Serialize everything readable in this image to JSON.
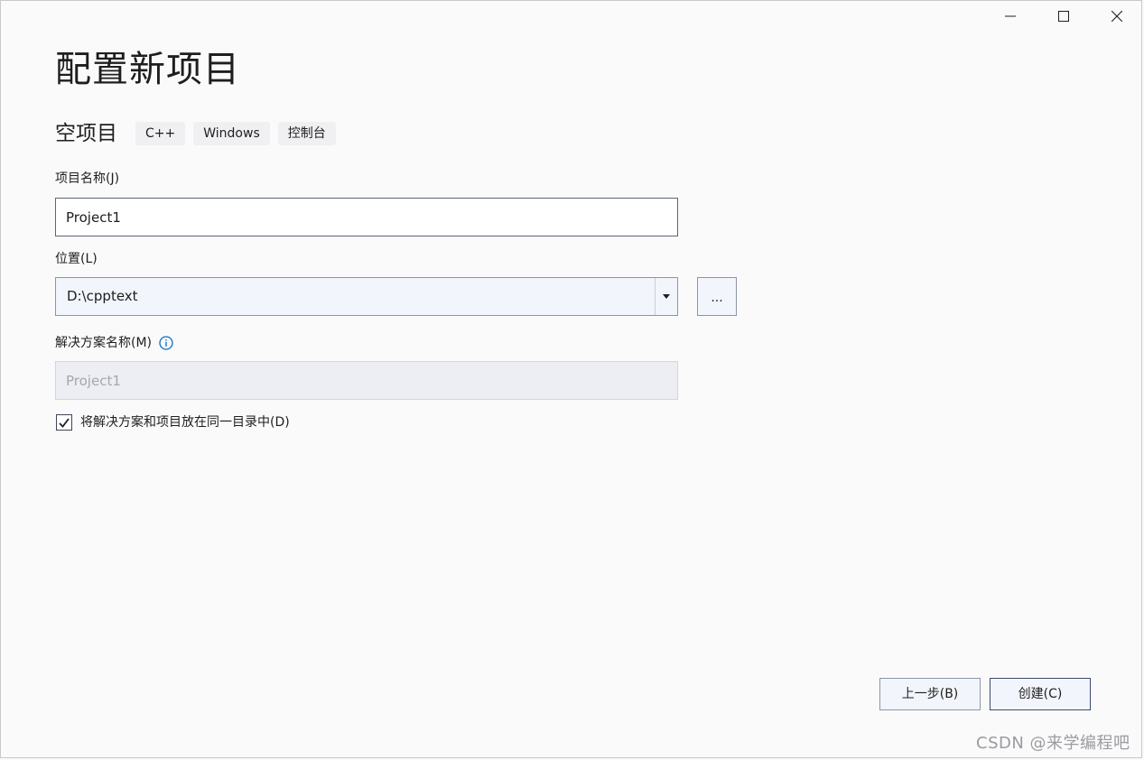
{
  "window": {
    "controls": {
      "minimize": "minimize-icon",
      "maximize": "maximize-icon",
      "close": "close-icon"
    }
  },
  "header": {
    "title": "配置新项目"
  },
  "template": {
    "name": "空项目",
    "tags": [
      "C++",
      "Windows",
      "控制台"
    ]
  },
  "form": {
    "project_name_label": "项目名称(J)",
    "project_name_value": "Project1",
    "location_label": "位置(L)",
    "location_value": "D:\\cpptext",
    "browse_label": "...",
    "solution_name_label": "解决方案名称(M)",
    "solution_name_value": "Project1",
    "same_dir_label": "将解决方案和项目放在同一目录中(D)",
    "same_dir_checked": true
  },
  "footer": {
    "back_label": "上一步(B)",
    "create_label": "创建(C)"
  },
  "watermark": "CSDN @来学编程吧",
  "colors": {
    "background": "#fafafb",
    "info_icon": "#0e70c0",
    "primary_border": "#3c4c6d"
  }
}
